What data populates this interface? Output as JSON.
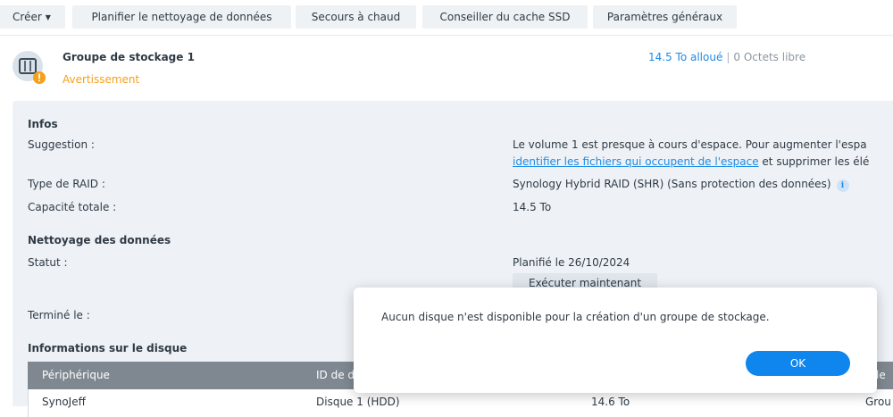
{
  "toolbar": {
    "create_label": "Créer",
    "schedule_scrub_label": "Planifier le nettoyage de données",
    "hot_spare_label": "Secours à chaud",
    "ssd_advisor_label": "Conseiller du cache SSD",
    "global_settings_label": "Paramètres généraux"
  },
  "pool": {
    "title": "Groupe de stockage 1",
    "status": "Avertissement",
    "allocated": "14.5 To alloué",
    "separator": "|",
    "free": "0 Octets libre"
  },
  "info": {
    "section_title": "Infos",
    "suggestion_label": "Suggestion :",
    "suggestion_line1": "Le volume 1 est presque à cours d'espace. Pour augmenter l'espa",
    "suggestion_link": "identifier les fichiers qui occupent de l'espace",
    "suggestion_line2_rest": " et supprimer les élé",
    "raid_label": "Type de RAID :",
    "raid_value": "Synology Hybrid RAID (SHR) (Sans protection des données)",
    "capacity_label": "Capacité totale :",
    "capacity_value": "14.5 To"
  },
  "scrub": {
    "section_title": "Nettoyage des données",
    "status_label": "Statut :",
    "status_value": "Planifié le 26/10/2024",
    "run_now_label": "Exécuter maintenant",
    "finished_label": "Terminé le :"
  },
  "disks": {
    "section_title": "Informations sur le disque",
    "columns": [
      "Périphérique",
      "ID de d",
      "le"
    ],
    "rows": [
      {
        "device": "SynoJeff",
        "disk_id": "Disque 1 (HDD)",
        "size": "14.6 To",
        "pool": "Grou"
      }
    ]
  },
  "dialog": {
    "message": "Aucun disque n'est disponible pour la création d'un groupe de stockage.",
    "ok_label": "OK"
  },
  "colors": {
    "accent": "#0e86ee",
    "warning": "#f6a01a",
    "link": "#1d8be6",
    "panel_bg": "#eef2f6",
    "table_header": "#7f8890"
  }
}
